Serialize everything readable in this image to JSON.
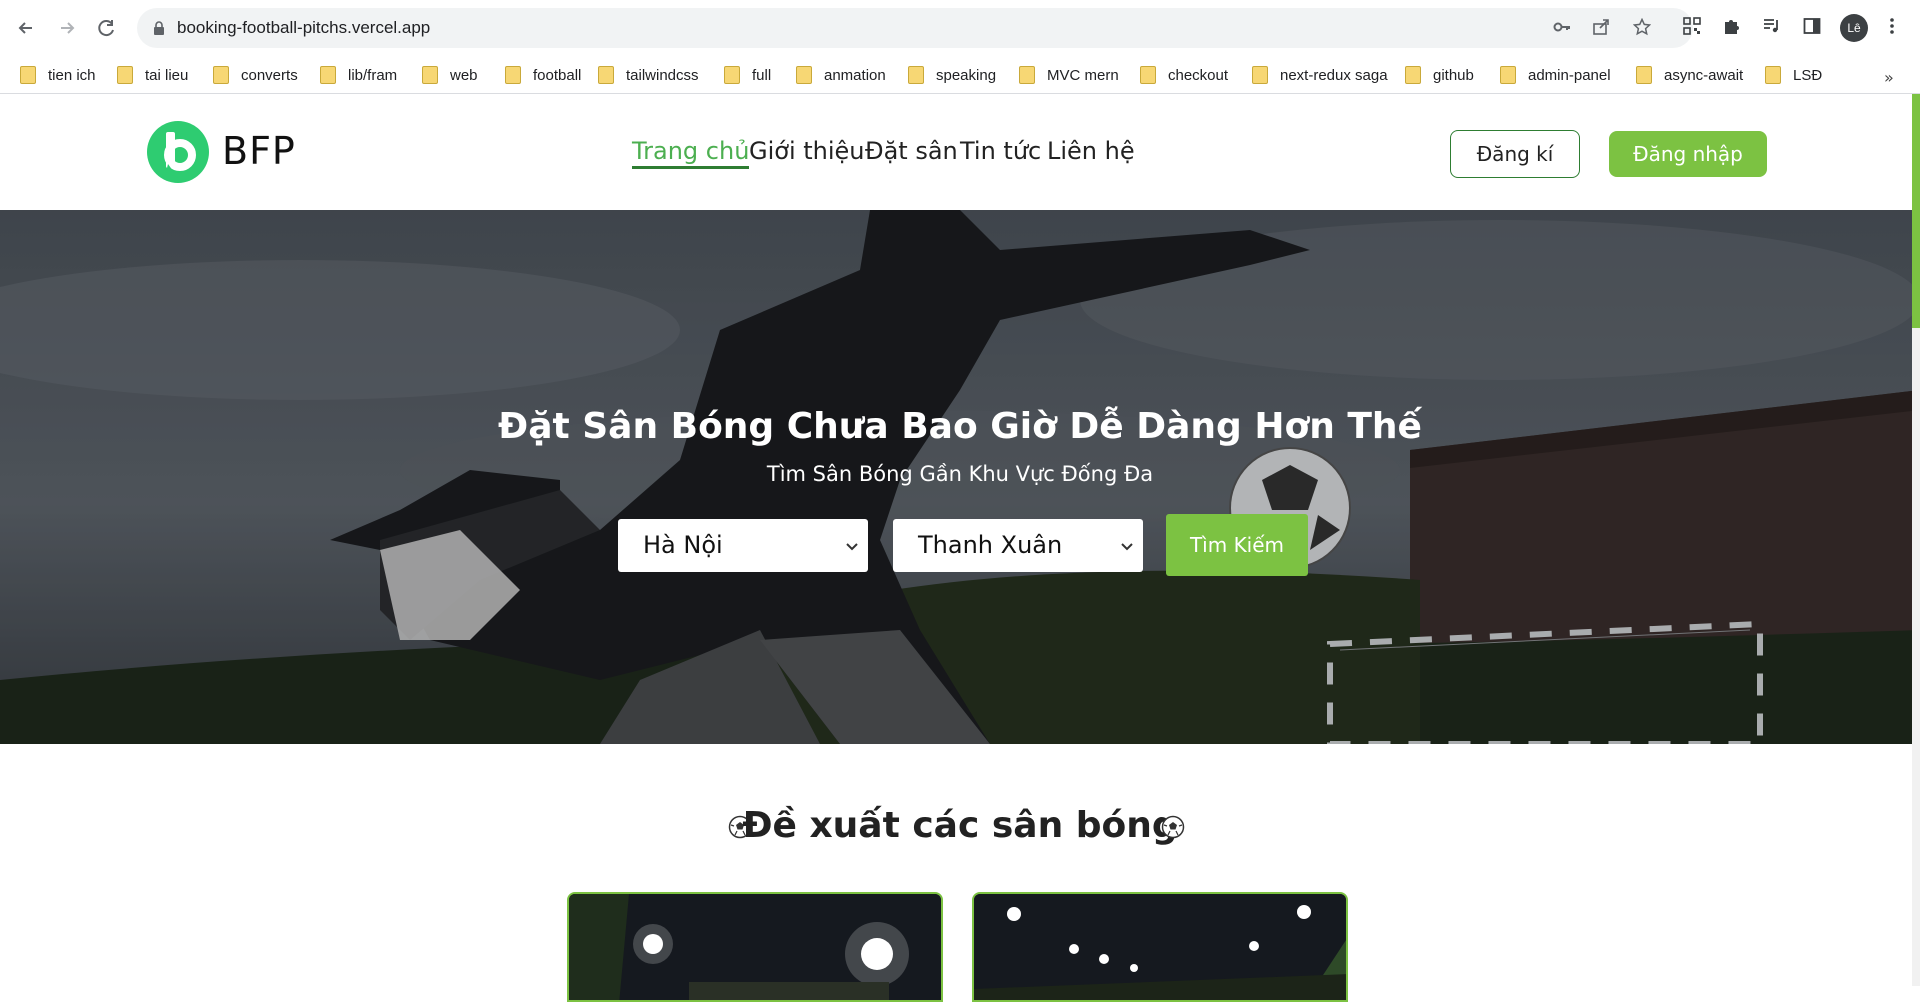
{
  "browser": {
    "url": "booking-football-pitchs.vercel.app",
    "avatar_label": "Lê",
    "icons": [
      "back-arrow-icon",
      "forward-arrow-icon",
      "reload-icon",
      "lock-icon",
      "key-icon",
      "share-icon",
      "star-icon",
      "qr-icon",
      "puzzle-icon",
      "media-icon",
      "sidebar-icon",
      "kebab-menu-icon"
    ]
  },
  "bookmarks": [
    {
      "label": "tien ich"
    },
    {
      "label": "tai lieu"
    },
    {
      "label": "converts"
    },
    {
      "label": "lib/fram"
    },
    {
      "label": "web"
    },
    {
      "label": "football"
    },
    {
      "label": "tailwindcss"
    },
    {
      "label": "full"
    },
    {
      "label": "anmation"
    },
    {
      "label": "speaking"
    },
    {
      "label": "MVC mern"
    },
    {
      "label": "checkout"
    },
    {
      "label": "next-redux saga"
    },
    {
      "label": "github"
    },
    {
      "label": "admin-panel"
    },
    {
      "label": "async-await"
    },
    {
      "label": "LSĐ"
    }
  ],
  "header": {
    "brand": "BFP",
    "nav": [
      {
        "label": "Trang chủ",
        "active": true
      },
      {
        "label": "Giới thiệu",
        "active": false
      },
      {
        "label": "Đặt sân",
        "active": false
      },
      {
        "label": "Tin tức",
        "active": false
      },
      {
        "label": "Liên hệ",
        "active": false
      }
    ],
    "register_label": "Đăng kí",
    "login_label": "Đăng nhập"
  },
  "hero": {
    "title": "Đặt Sân Bóng Chưa Bao Giờ Dễ Dàng Hơn Thế",
    "subtitle": "Tìm Sân Bóng Gần Khu Vực Đống Đa",
    "city_value": "Hà Nội",
    "district_value": "Thanh Xuân",
    "search_label": "Tìm Kiếm"
  },
  "section": {
    "title": "Đề xuất các sân bóng"
  },
  "colors": {
    "accent": "#7cc242",
    "nav_active": "#4caf50",
    "logo": "#2ecc71"
  }
}
